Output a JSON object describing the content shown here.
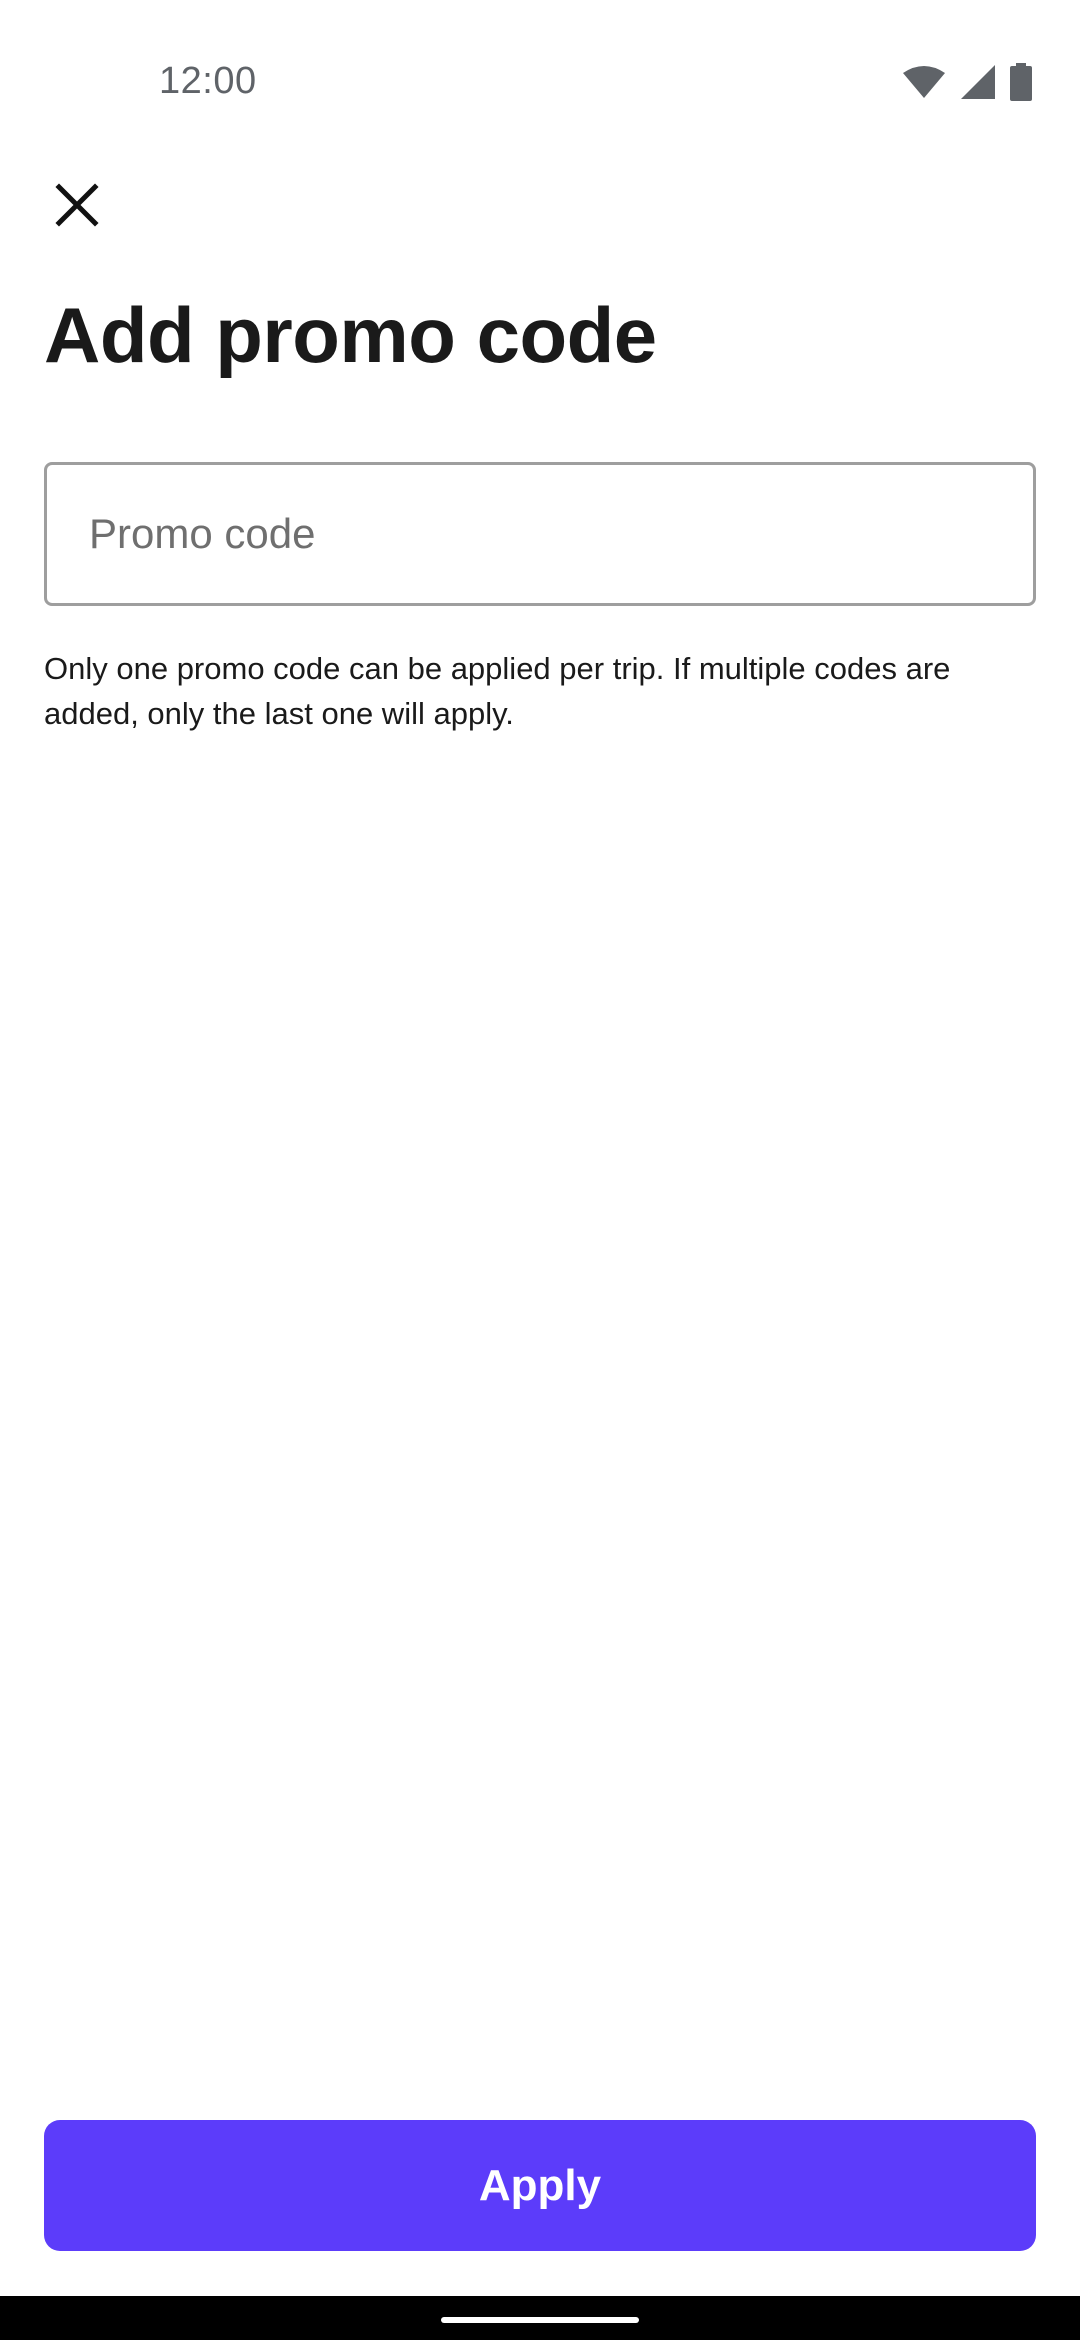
{
  "status_bar": {
    "time": "12:00",
    "icons": [
      "wifi-icon",
      "cellular-signal-icon",
      "battery-icon"
    ]
  },
  "header": {
    "close_icon": "close-icon",
    "title": "Add promo code"
  },
  "promo": {
    "placeholder": "Promo code",
    "value": "",
    "helper": "Only one promo code can be applied per trip. If multiple codes are added, only the last one will apply."
  },
  "footer": {
    "apply_label": "Apply"
  },
  "colors": {
    "accent": "#5c3cfa",
    "text": "#1a1a1a",
    "placeholder": "#6f6f6f",
    "border": "#9e9e9e"
  }
}
